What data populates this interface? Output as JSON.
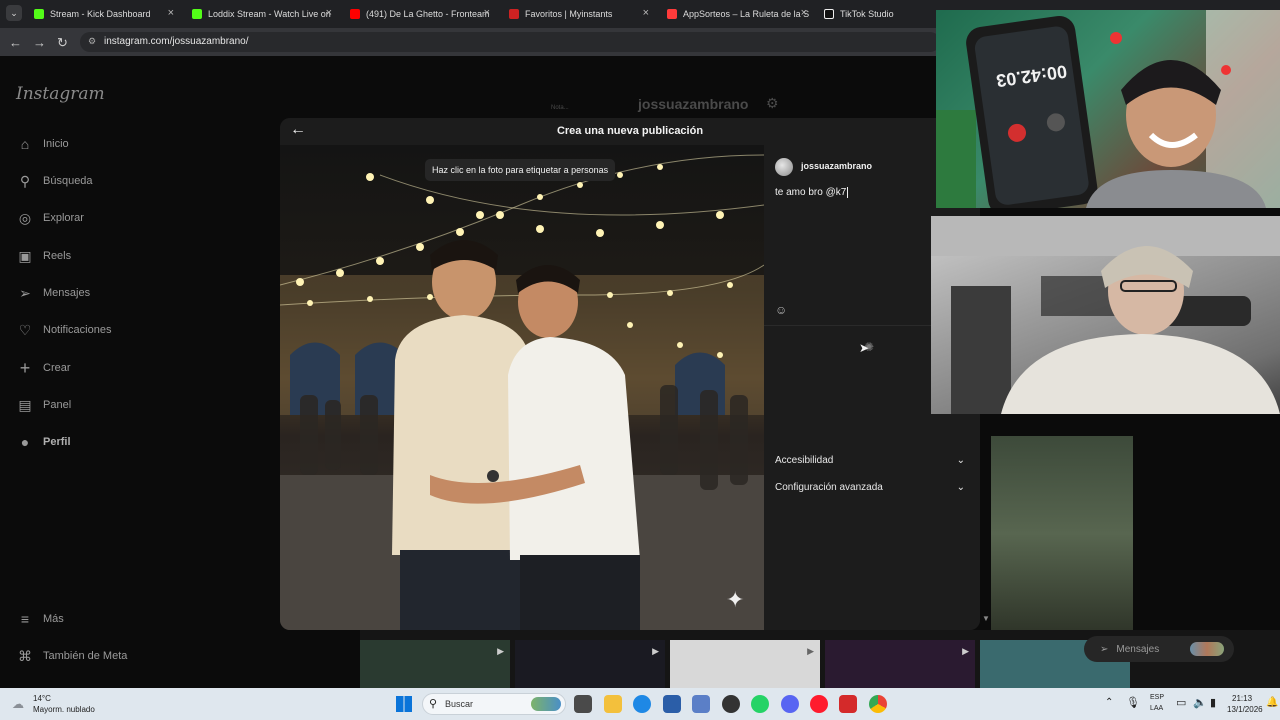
{
  "browser": {
    "tabs": [
      {
        "title": "Stream - Kick Dashboard",
        "color": "#53fc18"
      },
      {
        "title": "Loddix Stream - Watch Live on",
        "color": "#53fc18"
      },
      {
        "title": "(491) De La Ghetto - Fronteam",
        "color": "#ff0000"
      },
      {
        "title": "Favoritos | Myinstants",
        "color": "#e33"
      },
      {
        "title": "AppSorteos – La Ruleta de la S",
        "color": "#ff3b3b"
      },
      {
        "title": "TikTok Studio",
        "color": "#ffffff"
      }
    ],
    "url": "instagram.com/jossuazambrano/"
  },
  "instagram": {
    "logo": "Instagram",
    "nav": [
      {
        "label": "Inicio",
        "icon": "home-icon",
        "glyph": "⌂"
      },
      {
        "label": "Búsqueda",
        "icon": "search-icon",
        "glyph": "⚲"
      },
      {
        "label": "Explorar",
        "icon": "compass-icon",
        "glyph": "◎"
      },
      {
        "label": "Reels",
        "icon": "reels-icon",
        "glyph": "▣"
      },
      {
        "label": "Mensajes",
        "icon": "messages-icon",
        "glyph": "➢"
      },
      {
        "label": "Notificaciones",
        "icon": "heart-icon",
        "glyph": "♡"
      },
      {
        "label": "Crear",
        "icon": "plus-icon",
        "glyph": "+"
      },
      {
        "label": "Panel",
        "icon": "chart-icon",
        "glyph": "▤"
      },
      {
        "label": "Perfil",
        "icon": "avatar-icon",
        "glyph": "●"
      }
    ],
    "more": {
      "label": "Más",
      "icon": "menu-icon",
      "glyph": "≡"
    },
    "meta": {
      "label": "También de Meta",
      "icon": "meta-icon",
      "glyph": "⌘"
    },
    "note_label": "Nota...",
    "profile_username": "jossuazambrano"
  },
  "modal": {
    "title": "Crea una nueva publicación",
    "tag_tip": "Haz clic en la foto para etiquetar a personas",
    "username": "jossuazambrano",
    "caption": "te amo bro @k7",
    "accessibility_label": "Accesibilidad",
    "advanced_label": "Configuración avanzada"
  },
  "messages_pill": {
    "label": "Mensajes"
  },
  "taskbar": {
    "weather_temp": "14°C",
    "weather_desc": "Mayorm. nublado",
    "search_placeholder": "Buscar",
    "lang_top": "ESP",
    "lang_bottom": "LAA",
    "time": "21:13",
    "date": "13/1/2026"
  },
  "cam1_timer": "00:42.03"
}
